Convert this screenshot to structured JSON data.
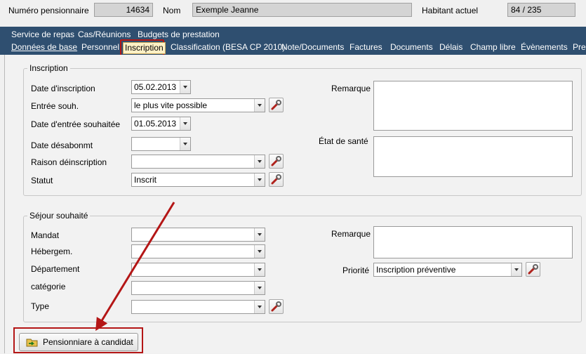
{
  "header": {
    "resident_number_label": "Numéro pensionnaire",
    "resident_number_value": "14634",
    "name_label": "Nom",
    "name_value": "Exemple Jeanne",
    "current_resident_label": "Habitant actuel",
    "current_resident_value": "84 / 235"
  },
  "tabs_row1": [
    "Service de repas",
    "Cas/Réunions",
    "Budgets de prestation"
  ],
  "tabs_row2": [
    "Données de base",
    "Personnel",
    "Inscription",
    "Classification (BESA CP 2010)",
    "Note/Documents",
    "Factures",
    "Documents",
    "Délais",
    "Champ libre",
    "Évènements",
    "Pres"
  ],
  "inscription": {
    "group_label": "Inscription",
    "date_label": "Date d'inscription",
    "date_value": "05.02.2013",
    "entry_label": "Entrée souh.",
    "entry_value": "le plus vite possible",
    "entry_date_label": "Date d'entrée souhaitée",
    "entry_date_value": "01.05.2013",
    "unsub_date_label": "Date désabonmt",
    "unsub_date_value": "",
    "unsub_reason_label": "Raison déinscription",
    "unsub_reason_value": "",
    "status_label": "Statut",
    "status_value": "Inscrit",
    "remark_label": "Remarque",
    "health_label": "État de santé"
  },
  "sejour": {
    "group_label": "Séjour souhaité",
    "mandat_label": "Mandat",
    "hebergem_label": "Hébergem.",
    "departement_label": "Département",
    "categorie_label": "catégorie",
    "type_label": "Type",
    "remark_label": "Remarque",
    "priority_label": "Priorité",
    "priority_value": "Inscription préventive"
  },
  "actions": {
    "to_candidate_label": "Pensionniare à candidat"
  },
  "colors": {
    "tabbar": "#2f4f70",
    "highlight": "#b41616",
    "active_tab": "#fff1c6"
  }
}
